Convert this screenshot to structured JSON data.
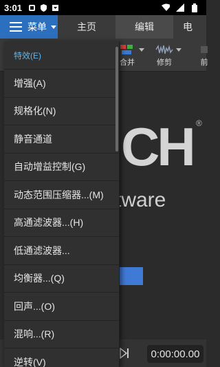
{
  "status": {
    "time": "3:01"
  },
  "appbar": {
    "menu_label": "菜单",
    "tabs": [
      {
        "label": "主页"
      },
      {
        "label": "编辑"
      },
      {
        "label": "电"
      }
    ]
  },
  "toolbar": {
    "merge_label": "合并",
    "trim_label": "修剪",
    "partial_label": "前"
  },
  "workspace": {
    "logo_letters": "CH",
    "logo_reg": "®",
    "logo_tail": "tware"
  },
  "playback": {
    "timecode": "0:00:00.00"
  },
  "dropdown": {
    "header": "特效(E)",
    "items": [
      {
        "label": "增强(A)"
      },
      {
        "label": "规格化(N)"
      },
      {
        "label": "静音通道"
      },
      {
        "label": "自动增益控制(G)"
      },
      {
        "label": "动态范围压缩器...(M)"
      },
      {
        "label": "高通滤波器...(H)"
      },
      {
        "label": "低通滤波器..."
      },
      {
        "label": "均衡器...(Q)"
      },
      {
        "label": "回声...(O)"
      },
      {
        "label": "混响...(R)"
      },
      {
        "label": "逆转(V)"
      }
    ]
  },
  "colors": {
    "accent": "#2d6fbf",
    "header": "#5fb6ea"
  }
}
